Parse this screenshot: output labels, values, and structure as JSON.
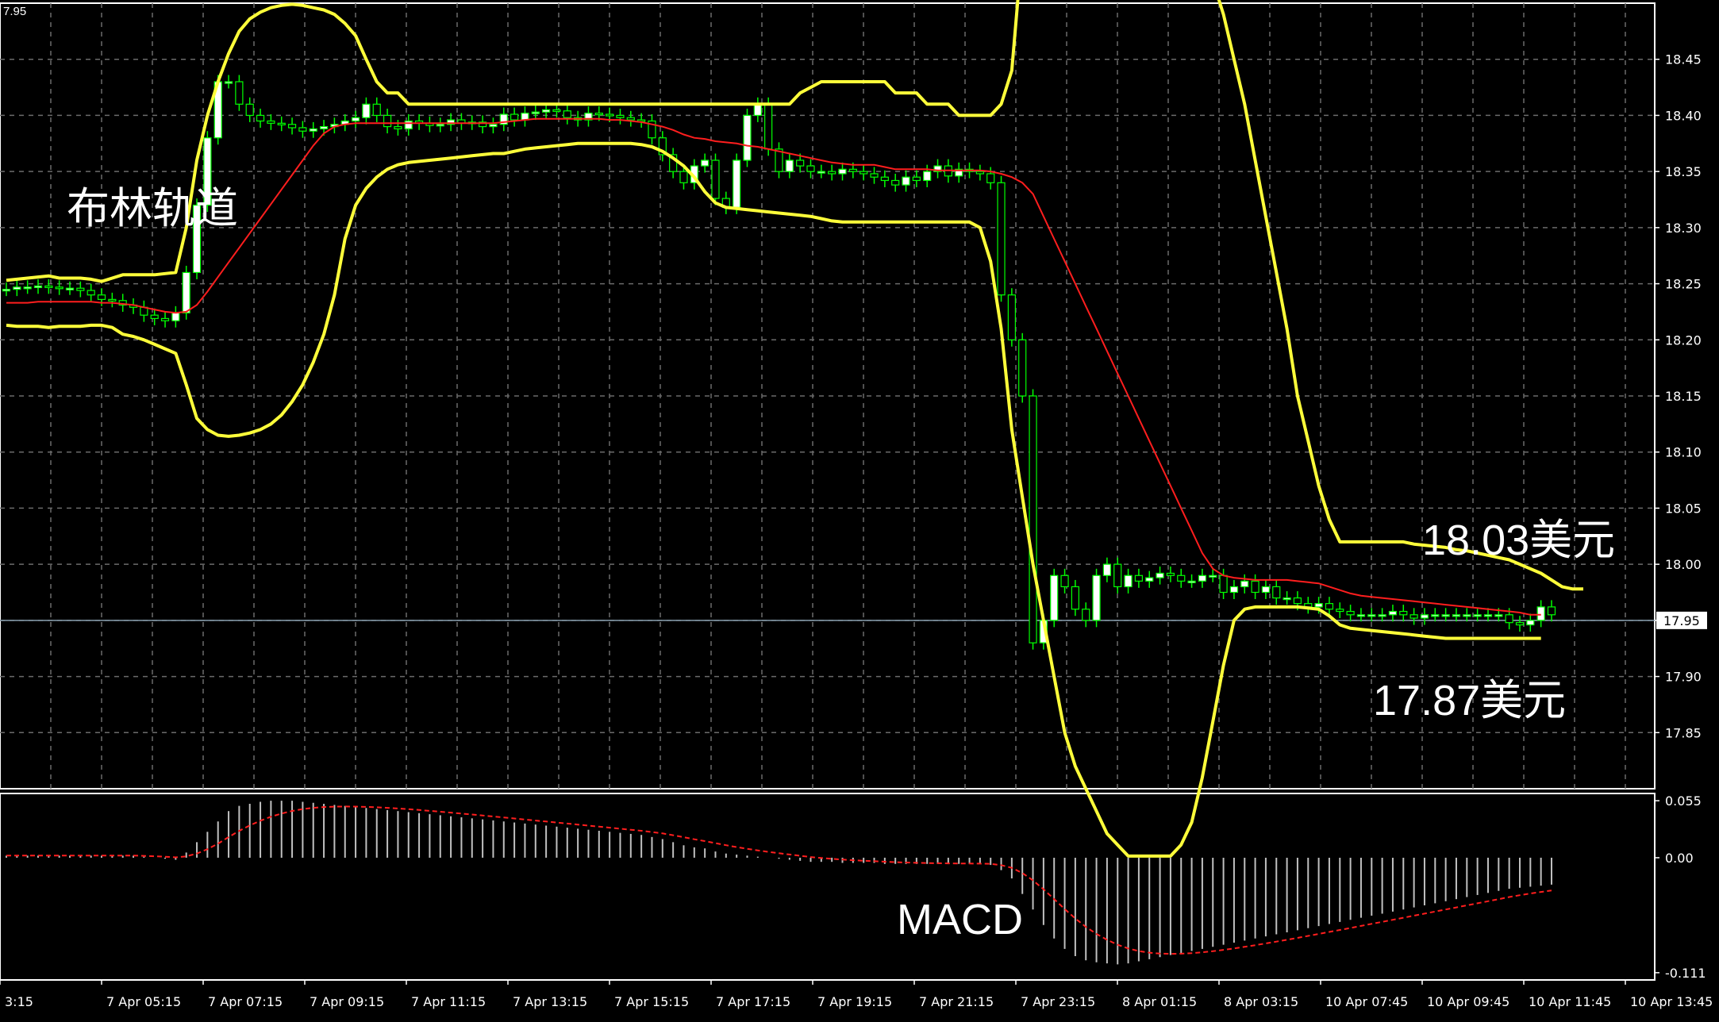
{
  "chart_data": {
    "type": "candlestick",
    "symbol_last": "17.95",
    "annotations": {
      "bollinger": "布林轨道",
      "upper_price": "18.03美元",
      "lower_price": "17.87美元",
      "macd": "MACD",
      "top_left": "7.95"
    },
    "price_axis": {
      "ylim": [
        17.8,
        18.5
      ],
      "ticks": [
        "18.45",
        "18.40",
        "18.35",
        "18.30",
        "18.25",
        "18.20",
        "18.15",
        "18.10",
        "18.05",
        "18.00",
        "17.95",
        "17.90",
        "17.85"
      ],
      "current": "17.95"
    },
    "macd_axis": {
      "ylim": [
        -0.118,
        0.062
      ],
      "ticks": [
        "0.055",
        "0.00",
        "-0.111"
      ]
    },
    "time_axis": {
      "labels": [
        "3:15",
        "7 Apr 05:15",
        "7 Apr 07:15",
        "7 Apr 09:15",
        "7 Apr 11:15",
        "7 Apr 13:15",
        "7 Apr 15:15",
        "7 Apr 17:15",
        "7 Apr 19:15",
        "7 Apr 21:15",
        "7 Apr 23:15",
        "8 Apr 01:15",
        "8 Apr 03:15",
        "10 Apr 07:45",
        "10 Apr 09:45",
        "10 Apr 11:45",
        "10 Apr 13:45"
      ]
    },
    "series": [
      {
        "name": "upper_band",
        "values": [
          18.253,
          18.254,
          18.255,
          18.256,
          18.257,
          18.255,
          18.255,
          18.255,
          18.254,
          18.252,
          18.255,
          18.258,
          18.258,
          18.258,
          18.258,
          18.259,
          18.26,
          18.3,
          18.36,
          18.4,
          18.43,
          18.455,
          18.475,
          18.486,
          18.492,
          18.496,
          18.498,
          18.499,
          18.498,
          18.496,
          18.494,
          18.49,
          18.482,
          18.471,
          18.45,
          18.43,
          18.42,
          18.42,
          18.41,
          18.41,
          18.41,
          18.41,
          18.41,
          18.41,
          18.41,
          18.41,
          18.41,
          18.41,
          18.41,
          18.41,
          18.41,
          18.41,
          18.41,
          18.41,
          18.41,
          18.41,
          18.41,
          18.41,
          18.41,
          18.41,
          18.41,
          18.41,
          18.41,
          18.41,
          18.41,
          18.41,
          18.41,
          18.41,
          18.41,
          18.41,
          18.41,
          18.41,
          18.41,
          18.41,
          18.41,
          18.42,
          18.425,
          18.43,
          18.43,
          18.43,
          18.43,
          18.43,
          18.43,
          18.43,
          18.42,
          18.42,
          18.42,
          18.41,
          18.41,
          18.41,
          18.4,
          18.4,
          18.4,
          18.4,
          18.41,
          18.44,
          18.55,
          18.6,
          18.6,
          18.6,
          18.6,
          18.6,
          18.6,
          18.6,
          18.6,
          18.6,
          18.6,
          18.6,
          18.6,
          18.6,
          18.6,
          18.6,
          18.58,
          18.55,
          18.52,
          18.49,
          18.45,
          18.41,
          18.36,
          18.31,
          18.26,
          18.21,
          18.15,
          18.11,
          18.07,
          18.04,
          18.02,
          18.02,
          18.02,
          18.02,
          18.02,
          18.02,
          18.02,
          18.018,
          18.017,
          18.016,
          18.015,
          18.013,
          18.012,
          18.01,
          18.008,
          18.006,
          18.004,
          18.0,
          17.996,
          17.992,
          17.986,
          17.98,
          17.978,
          17.978
        ]
      },
      {
        "name": "middle_band",
        "values": [
          18.233,
          18.233,
          18.233,
          18.234,
          18.234,
          18.234,
          18.234,
          18.234,
          18.234,
          18.233,
          18.233,
          18.232,
          18.231,
          18.229,
          18.227,
          18.225,
          18.224,
          18.225,
          18.231,
          18.243,
          18.256,
          18.269,
          18.282,
          18.295,
          18.308,
          18.321,
          18.334,
          18.347,
          18.36,
          18.373,
          18.384,
          18.39,
          18.392,
          18.393,
          18.393,
          18.393,
          18.393,
          18.393,
          18.393,
          18.393,
          18.393,
          18.393,
          18.393,
          18.393,
          18.393,
          18.393,
          18.393,
          18.394,
          18.395,
          18.396,
          18.397,
          18.397,
          18.397,
          18.397,
          18.397,
          18.397,
          18.397,
          18.396,
          18.396,
          18.395,
          18.394,
          18.392,
          18.39,
          18.387,
          18.383,
          18.38,
          18.379,
          18.377,
          18.376,
          18.375,
          18.373,
          18.372,
          18.37,
          18.368,
          18.366,
          18.364,
          18.362,
          18.36,
          18.358,
          18.357,
          18.356,
          18.356,
          18.356,
          18.354,
          18.352,
          18.352,
          18.352,
          18.352,
          18.351,
          18.351,
          18.351,
          18.351,
          18.351,
          18.35,
          18.348,
          18.345,
          18.34,
          18.33,
          18.31,
          18.29,
          18.27,
          18.25,
          18.23,
          18.21,
          18.19,
          18.17,
          18.15,
          18.13,
          18.11,
          18.09,
          18.07,
          18.05,
          18.03,
          18.01,
          17.996,
          17.99,
          17.988,
          17.987,
          17.986,
          17.986,
          17.986,
          17.986,
          17.985,
          17.984,
          17.983,
          17.98,
          17.977,
          17.974,
          17.972,
          17.971,
          17.97,
          17.969,
          17.968,
          17.967,
          17.966,
          17.965,
          17.964,
          17.963,
          17.962,
          17.961,
          17.96,
          17.959,
          17.958,
          17.957,
          17.955,
          17.955
        ]
      },
      {
        "name": "lower_band",
        "values": [
          18.213,
          18.212,
          18.212,
          18.212,
          18.211,
          18.212,
          18.212,
          18.212,
          18.213,
          18.213,
          18.211,
          18.205,
          18.203,
          18.2,
          18.196,
          18.192,
          18.188,
          18.16,
          18.13,
          18.12,
          18.115,
          18.114,
          18.115,
          18.117,
          18.12,
          18.125,
          18.133,
          18.145,
          18.16,
          18.18,
          18.205,
          18.24,
          18.29,
          18.32,
          18.335,
          18.345,
          18.352,
          18.356,
          18.358,
          18.359,
          18.36,
          18.361,
          18.362,
          18.363,
          18.364,
          18.365,
          18.366,
          18.366,
          18.368,
          18.37,
          18.371,
          18.372,
          18.373,
          18.374,
          18.375,
          18.375,
          18.375,
          18.375,
          18.375,
          18.375,
          18.374,
          18.372,
          18.368,
          18.362,
          18.355,
          18.345,
          18.332,
          18.322,
          18.318,
          18.317,
          18.316,
          18.315,
          18.314,
          18.313,
          18.312,
          18.311,
          18.31,
          18.308,
          18.306,
          18.305,
          18.305,
          18.305,
          18.305,
          18.305,
          18.305,
          18.305,
          18.305,
          18.305,
          18.305,
          18.305,
          18.305,
          18.305,
          18.3,
          18.27,
          18.21,
          18.12,
          18.06,
          18.0,
          17.95,
          17.9,
          17.85,
          17.82,
          17.8,
          17.78,
          17.76,
          17.75,
          17.74,
          17.74,
          17.74,
          17.74,
          17.74,
          17.75,
          17.77,
          17.81,
          17.86,
          17.91,
          17.95,
          17.96,
          17.962,
          17.962,
          17.962,
          17.962,
          17.962,
          17.961,
          17.96,
          17.954,
          17.946,
          17.943,
          17.942,
          17.941,
          17.94,
          17.939,
          17.938,
          17.937,
          17.936,
          17.935,
          17.934,
          17.934,
          17.934,
          17.934,
          17.934,
          17.934,
          17.934,
          17.934,
          17.934,
          17.934
        ]
      }
    ],
    "candles_close": [
      18.245,
      18.247,
      18.247,
      18.248,
      18.247,
      18.246,
      18.246,
      18.244,
      18.24,
      18.236,
      18.235,
      18.231,
      18.229,
      18.222,
      18.219,
      18.217,
      18.224,
      18.26,
      18.32,
      18.38,
      18.43,
      18.43,
      18.41,
      18.4,
      18.395,
      18.393,
      18.392,
      18.389,
      18.386,
      18.388,
      18.39,
      18.392,
      18.395,
      18.398,
      18.41,
      18.4,
      18.39,
      18.388,
      18.395,
      18.393,
      18.391,
      18.392,
      18.396,
      18.393,
      18.394,
      18.39,
      18.392,
      18.401,
      18.396,
      18.402,
      18.403,
      18.405,
      18.404,
      18.398,
      18.396,
      18.402,
      18.401,
      18.4,
      18.398,
      18.396,
      18.395,
      18.38,
      18.365,
      18.35,
      18.34,
      18.355,
      18.36,
      18.326,
      18.318,
      18.36,
      18.4,
      18.41,
      18.37,
      18.35,
      18.36,
      18.355,
      18.35,
      18.35,
      18.348,
      18.352,
      18.35,
      18.348,
      18.345,
      18.342,
      18.338,
      18.345,
      18.342,
      18.35,
      18.355,
      18.346,
      18.352,
      18.35,
      18.348,
      18.34,
      18.24,
      18.2,
      18.15,
      17.93,
      17.95,
      17.99,
      17.98,
      17.96,
      17.95,
      17.99,
      18.0,
      17.98,
      17.99,
      17.985,
      17.988,
      17.992,
      17.99,
      17.985,
      17.985,
      17.99,
      17.99,
      17.975,
      17.98,
      17.985,
      17.975,
      17.98,
      17.97,
      17.97,
      17.965,
      17.962,
      17.965,
      17.96,
      17.958,
      17.955,
      17.955,
      17.955,
      17.955,
      17.958,
      17.955,
      17.952,
      17.955,
      17.955,
      17.955,
      17.955,
      17.955,
      17.955,
      17.955,
      17.955,
      17.948,
      17.946,
      17.95,
      17.962,
      17.955
    ],
    "macd_values": [
      0.002,
      0.002,
      0.002,
      0.002,
      0.002,
      0.002,
      0.002,
      0.002,
      0.002,
      0.002,
      0.002,
      0.002,
      0.002,
      0.001,
      0.0,
      -0.001,
      -0.002,
      0.005,
      0.015,
      0.025,
      0.035,
      0.045,
      0.05,
      0.052,
      0.054,
      0.055,
      0.055,
      0.055,
      0.054,
      0.053,
      0.052,
      0.051,
      0.05,
      0.049,
      0.048,
      0.047,
      0.046,
      0.045,
      0.044,
      0.043,
      0.042,
      0.041,
      0.04,
      0.039,
      0.038,
      0.037,
      0.036,
      0.035,
      0.034,
      0.033,
      0.032,
      0.031,
      0.03,
      0.029,
      0.028,
      0.027,
      0.026,
      0.025,
      0.024,
      0.023,
      0.022,
      0.02,
      0.018,
      0.015,
      0.012,
      0.01,
      0.009,
      0.006,
      0.004,
      0.003,
      0.002,
      0.001,
      0.0,
      -0.001,
      -0.002,
      -0.003,
      -0.004,
      -0.004,
      -0.004,
      -0.005,
      -0.005,
      -0.005,
      -0.005,
      -0.006,
      -0.006,
      -0.006,
      -0.006,
      -0.006,
      -0.006,
      -0.006,
      -0.006,
      -0.006,
      -0.006,
      -0.007,
      -0.012,
      -0.02,
      -0.035,
      -0.05,
      -0.065,
      -0.078,
      -0.088,
      -0.095,
      -0.099,
      -0.101,
      -0.102,
      -0.103,
      -0.102,
      -0.1,
      -0.098,
      -0.096,
      -0.094,
      -0.092,
      -0.09,
      -0.088,
      -0.086,
      -0.084,
      -0.082,
      -0.08,
      -0.078,
      -0.076,
      -0.074,
      -0.072,
      -0.07,
      -0.068,
      -0.066,
      -0.064,
      -0.062,
      -0.06,
      -0.058,
      -0.056,
      -0.054,
      -0.052,
      -0.05,
      -0.048,
      -0.046,
      -0.044,
      -0.042,
      -0.04,
      -0.038,
      -0.036,
      -0.034,
      -0.032,
      -0.03,
      -0.029,
      -0.028,
      -0.027,
      -0.026
    ],
    "colors": {
      "background": "#000000",
      "grid": "#6b6b6b",
      "bands": "#ffff3a",
      "ma": "#ff1e1e",
      "candle_up": "#ffffff",
      "candle_down": "#000000",
      "candle_border": "#00ff00",
      "macd_hist": "#c0c0c0",
      "signal": "#ff1e1e",
      "axis_text": "#ffffff"
    }
  }
}
